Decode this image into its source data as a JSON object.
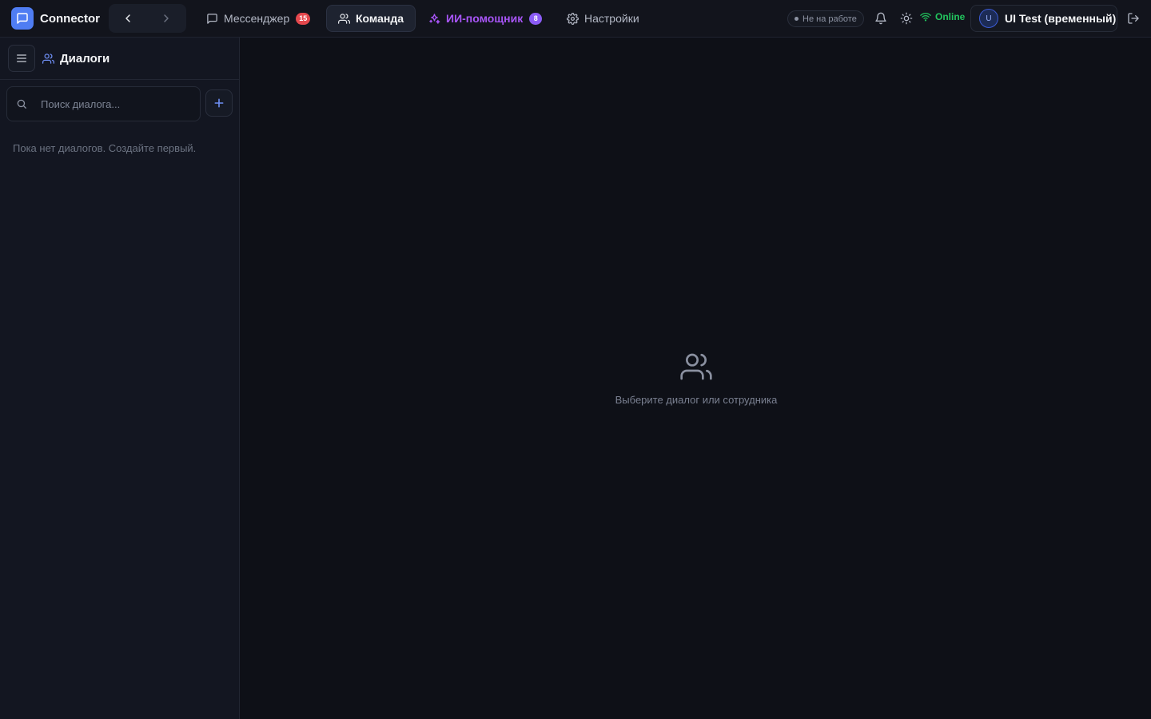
{
  "app": {
    "name": "Connector"
  },
  "header": {
    "tabs": [
      {
        "label": "Мессенджер",
        "badge": "15"
      },
      {
        "label": "Команда"
      },
      {
        "label": "ИИ-помощник",
        "badge": "8"
      },
      {
        "label": "Настройки"
      }
    ],
    "status": "Не на работе",
    "connection": "Online",
    "user": {
      "initial": "U",
      "name": "UI Test (временный)"
    }
  },
  "sidebar": {
    "title": "Диалоги",
    "search_placeholder": "Поиск диалога...",
    "empty_text": "Пока нет диалогов. Создайте первый."
  },
  "main": {
    "placeholder_text": "Выберите диалог или сотрудника"
  },
  "colors": {
    "accent": "#4f7df3",
    "ai": "#a855f7",
    "online": "#22c55e",
    "badge_red": "#e5484d",
    "badge_purple": "#8b5cf6"
  }
}
